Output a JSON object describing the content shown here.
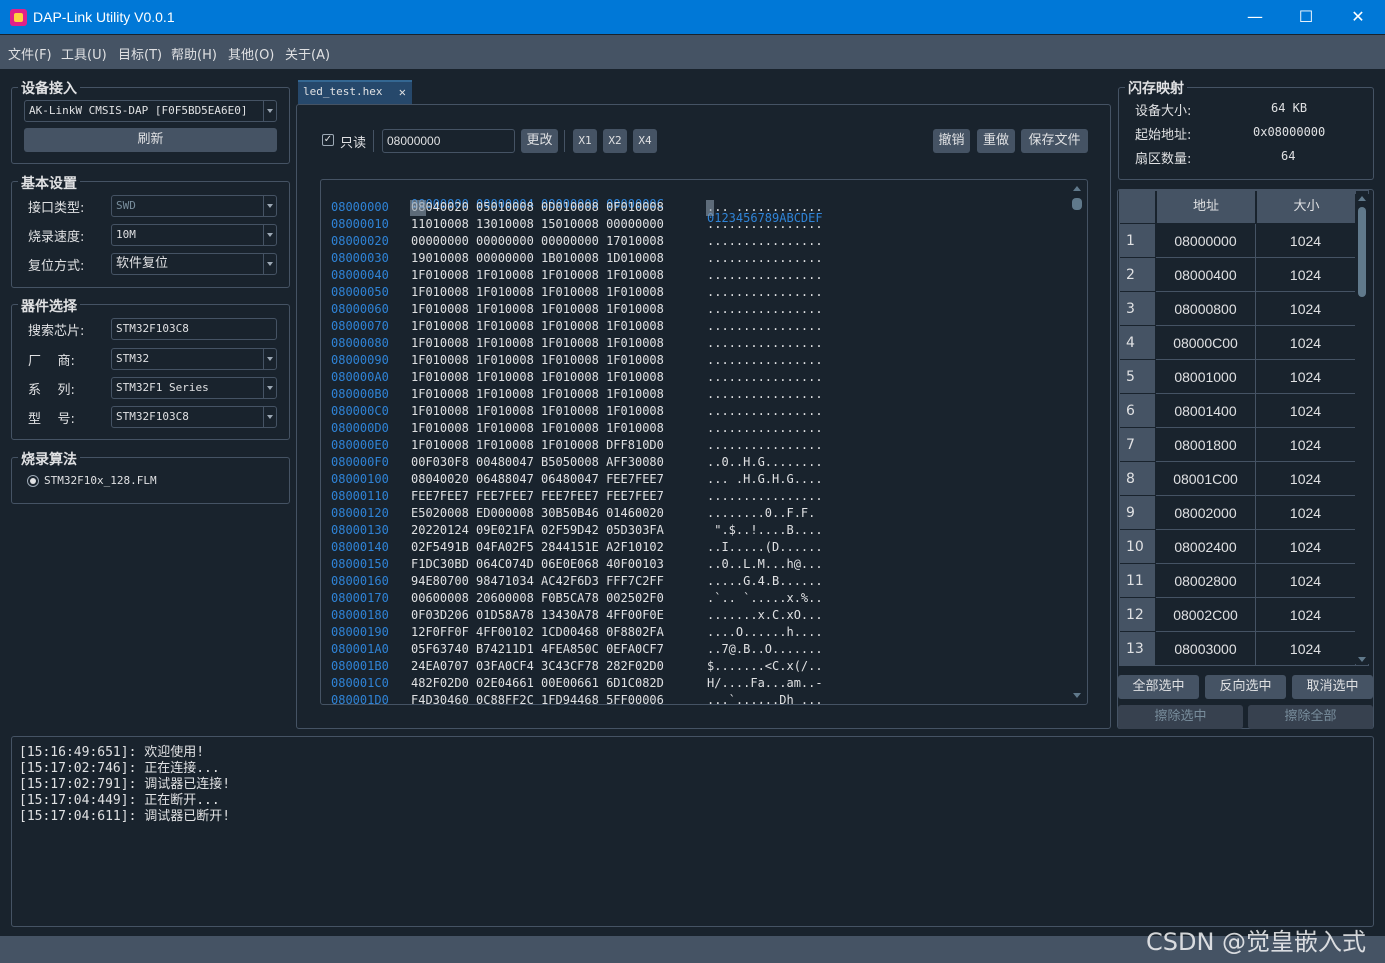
{
  "window": {
    "title": "DAP-Link Utility V0.0.1",
    "minimize": "—",
    "maximize": "☐",
    "close": "✕"
  },
  "menu": [
    "文件(F)",
    "工具(U)",
    "目标(T)",
    "帮助(H)",
    "其他(O)",
    "关于(A)"
  ],
  "device": {
    "title": "设备接入",
    "selected": "AK-LinkW CMSIS-DAP [F0F5BD5EA6E0]",
    "refresh": "刷新"
  },
  "basic": {
    "title": "基本设置",
    "interface_label": "接口类型:",
    "interface_value": "SWD",
    "speed_label": "烧录速度:",
    "speed_value": "10M",
    "reset_label": "复位方式:",
    "reset_value": "软件复位"
  },
  "chip": {
    "title": "器件选择",
    "search_label": "搜索芯片:",
    "search_value": "STM32F103C8",
    "vendor_label": "厂    商:",
    "vendor_value": "STM32",
    "series_label": "系    列:",
    "series_value": "STM32F1 Series",
    "model_label": "型    号:",
    "model_value": "STM32F103C8"
  },
  "algo": {
    "title": "烧录算法",
    "option": "STM32F10x_128.FLM"
  },
  "editor": {
    "tab": "led_test.hex",
    "readonly_label": "只读",
    "address_value": "08000000",
    "change": "更改",
    "x1": "X1",
    "x2": "X2",
    "x4": "X4",
    "undo": "撤销",
    "redo": "重做",
    "save": "保存文件",
    "header_hex": "00000000 00000004 00000008 0000000C",
    "header_ascii": "0123456789ABCDEF",
    "rows": [
      {
        "addr": "08000000",
        "hex": "08040020 05010008 0D010008 0F010008",
        "ascii": "... ............"
      },
      {
        "addr": "08000010",
        "hex": "11010008 13010008 15010008 00000000",
        "ascii": "................"
      },
      {
        "addr": "08000020",
        "hex": "00000000 00000000 00000000 17010008",
        "ascii": "................"
      },
      {
        "addr": "08000030",
        "hex": "19010008 00000000 1B010008 1D010008",
        "ascii": "................"
      },
      {
        "addr": "08000040",
        "hex": "1F010008 1F010008 1F010008 1F010008",
        "ascii": "................"
      },
      {
        "addr": "08000050",
        "hex": "1F010008 1F010008 1F010008 1F010008",
        "ascii": "................"
      },
      {
        "addr": "08000060",
        "hex": "1F010008 1F010008 1F010008 1F010008",
        "ascii": "................"
      },
      {
        "addr": "08000070",
        "hex": "1F010008 1F010008 1F010008 1F010008",
        "ascii": "................"
      },
      {
        "addr": "08000080",
        "hex": "1F010008 1F010008 1F010008 1F010008",
        "ascii": "................"
      },
      {
        "addr": "08000090",
        "hex": "1F010008 1F010008 1F010008 1F010008",
        "ascii": "................"
      },
      {
        "addr": "080000A0",
        "hex": "1F010008 1F010008 1F010008 1F010008",
        "ascii": "................"
      },
      {
        "addr": "080000B0",
        "hex": "1F010008 1F010008 1F010008 1F010008",
        "ascii": "................"
      },
      {
        "addr": "080000C0",
        "hex": "1F010008 1F010008 1F010008 1F010008",
        "ascii": "................"
      },
      {
        "addr": "080000D0",
        "hex": "1F010008 1F010008 1F010008 1F010008",
        "ascii": "................"
      },
      {
        "addr": "080000E0",
        "hex": "1F010008 1F010008 1F010008 DFF810D0",
        "ascii": "................"
      },
      {
        "addr": "080000F0",
        "hex": "00F030F8 00480047 B5050008 AFF30080",
        "ascii": "..0..H.G........"
      },
      {
        "addr": "08000100",
        "hex": "08040020 06488047 06480047 FEE7FEE7",
        "ascii": "... .H.G.H.G...."
      },
      {
        "addr": "08000110",
        "hex": "FEE7FEE7 FEE7FEE7 FEE7FEE7 FEE7FEE7",
        "ascii": "................"
      },
      {
        "addr": "08000120",
        "hex": "E5020008 ED000008 30B50B46 01460020",
        "ascii": "........0..F.F. "
      },
      {
        "addr": "08000130",
        "hex": "20220124 09E021FA 02F59D42 05D303FA",
        "ascii": " \".$..!....B...."
      },
      {
        "addr": "08000140",
        "hex": "02F5491B 04FA02F5 2844151E A2F10102",
        "ascii": "..I.....(D......"
      },
      {
        "addr": "08000150",
        "hex": "F1DC30BD 064C074D 06E0E068 40F00103",
        "ascii": "..0..L.M...h@..."
      },
      {
        "addr": "08000160",
        "hex": "94E80700 98471034 AC42F6D3 FFF7C2FF",
        "ascii": ".....G.4.B......"
      },
      {
        "addr": "08000170",
        "hex": "00600008 20600008 F0B5CA78 002502F0",
        "ascii": ".`.. `.....x.%.."
      },
      {
        "addr": "08000180",
        "hex": "0F03D206 01D58A78 13430A78 4FF00F0E",
        "ascii": ".......x.C.xO..."
      },
      {
        "addr": "08000190",
        "hex": "12F0FF0F 4FF00102 1CD00468 0F8802FA",
        "ascii": "....O......h...."
      },
      {
        "addr": "080001A0",
        "hex": "05F63740 B74211D1 4FEA850C 0EFA0CF7",
        "ascii": "..7@.B..O......."
      },
      {
        "addr": "080001B0",
        "hex": "24EA0707 03FA0CF4 3C43CF78 282F02D0",
        "ascii": "$.......<C.x(/.."
      },
      {
        "addr": "080001C0",
        "hex": "482F02D0 02E04661 00E00661 6D1C082D",
        "ascii": "H/....Fa...am..-"
      },
      {
        "addr": "080001D0",
        "hex": "F4D30460 0C88FF2C 1FD94468 5FF00006",
        "ascii": "...`...,..Dh_..."
      }
    ]
  },
  "flash": {
    "title": "闪存映射",
    "size_label": "设备大小:",
    "size_value": "64 KB",
    "start_label": "起始地址:",
    "start_value": "0x08000000",
    "sector_label": "扇区数量:",
    "sector_value": "64",
    "col_addr": "地址",
    "col_size": "大小",
    "rows": [
      {
        "n": "1",
        "addr": "08000000",
        "size": "1024"
      },
      {
        "n": "2",
        "addr": "08000400",
        "size": "1024"
      },
      {
        "n": "3",
        "addr": "08000800",
        "size": "1024"
      },
      {
        "n": "4",
        "addr": "08000C00",
        "size": "1024"
      },
      {
        "n": "5",
        "addr": "08001000",
        "size": "1024"
      },
      {
        "n": "6",
        "addr": "08001400",
        "size": "1024"
      },
      {
        "n": "7",
        "addr": "08001800",
        "size": "1024"
      },
      {
        "n": "8",
        "addr": "08001C00",
        "size": "1024"
      },
      {
        "n": "9",
        "addr": "08002000",
        "size": "1024"
      },
      {
        "n": "10",
        "addr": "08002400",
        "size": "1024"
      },
      {
        "n": "11",
        "addr": "08002800",
        "size": "1024"
      },
      {
        "n": "12",
        "addr": "08002C00",
        "size": "1024"
      },
      {
        "n": "13",
        "addr": "08003000",
        "size": "1024"
      }
    ],
    "select_all": "全部选中",
    "invert": "反向选中",
    "deselect": "取消选中",
    "erase_selected": "擦除选中",
    "erase_all": "擦除全部"
  },
  "log": [
    "[15:16:49:651]: 欢迎使用!",
    "[15:17:02:746]: 正在连接...",
    "[15:17:02:791]: 调试器已连接!",
    "[15:17:04:449]: 正在断开...",
    "[15:17:04:611]: 调试器已断开!"
  ],
  "watermark": "CSDN @觉皇嵌入式"
}
